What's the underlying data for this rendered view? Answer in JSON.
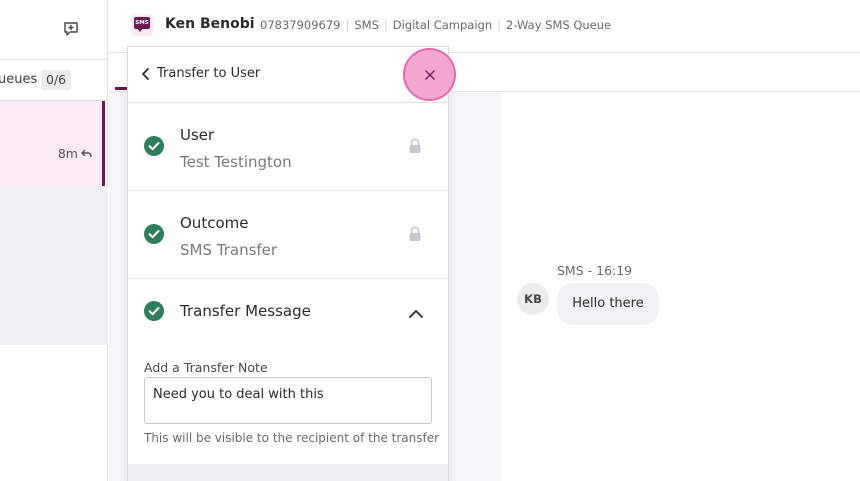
{
  "sidebar": {
    "queues_label": "ueues",
    "queues_count": "0/6",
    "conversation_time": "8m"
  },
  "header": {
    "contact_name": "Ken Benobi",
    "badge_text": "SMS",
    "meta": [
      "07837909679",
      "SMS",
      "Digital Campaign",
      "2-Way SMS Queue"
    ]
  },
  "transfer": {
    "title": "Transfer to User",
    "steps": [
      {
        "title": "User",
        "value": "Test Testington"
      },
      {
        "title": "Outcome",
        "value": "SMS Transfer"
      },
      {
        "title": "Transfer Message"
      }
    ],
    "note_label": "Add a Transfer Note",
    "note_value": "Need you to deal with this",
    "note_hint": "This will be visible to the recipient of the transfer"
  },
  "message": {
    "meta": "SMS - 16:19",
    "avatar": "KB",
    "text": "Hello there"
  },
  "colors": {
    "brand": "#6b1a55",
    "success": "#2e7d5b",
    "close_highlight": "#f2a6d0"
  }
}
